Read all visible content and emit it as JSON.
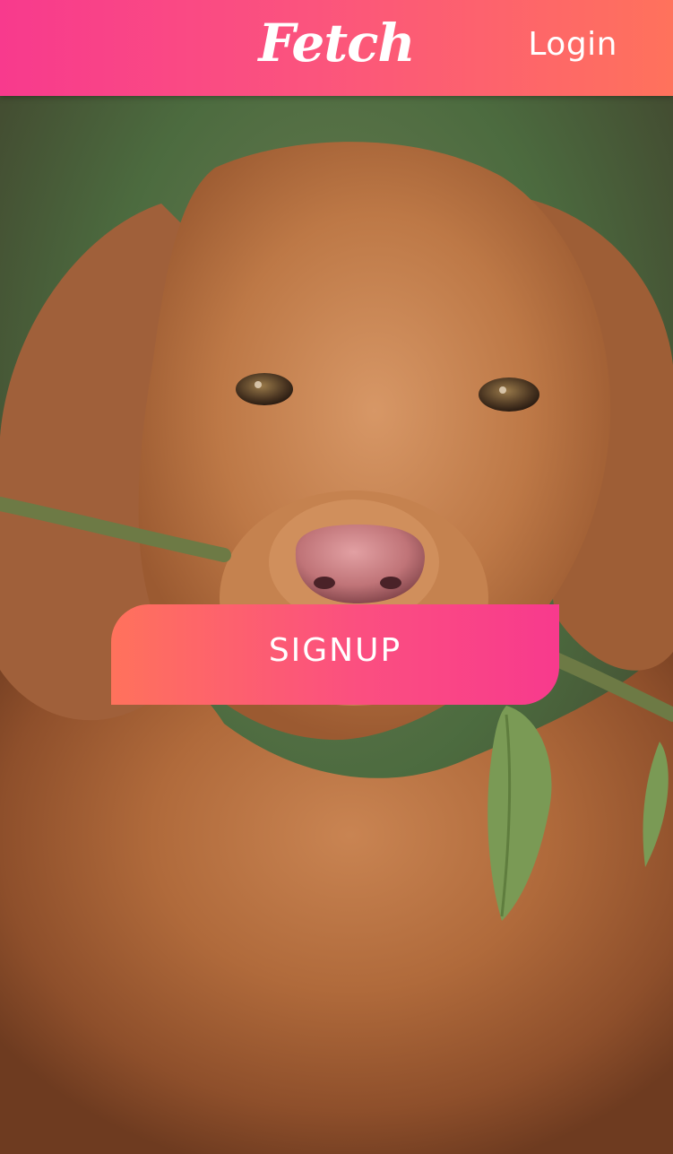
{
  "header": {
    "brand": "Fetch",
    "login_label": "Login",
    "gradient": [
      "#f83a8d",
      "#ff725c"
    ]
  },
  "hero": {
    "image_alt": "",
    "icon": "dog-photo"
  },
  "cta": {
    "signup_label": "SIGNUP",
    "gradient": [
      "#ff725c",
      "#f83a8d"
    ]
  }
}
